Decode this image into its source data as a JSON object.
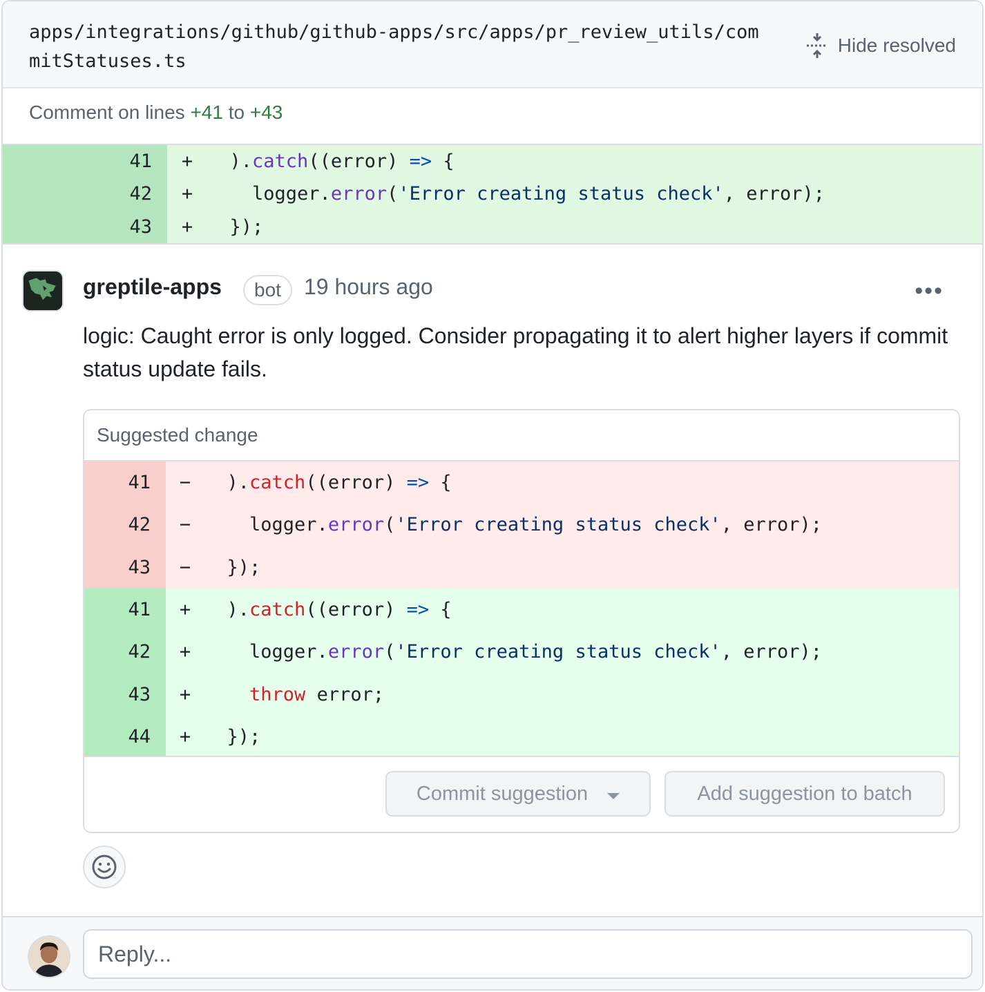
{
  "file": {
    "path": "apps/integrations/github/github-apps/src/apps/pr_review_utils/commitStatuses.ts",
    "hide_resolved_label": "Hide resolved"
  },
  "comment_range": {
    "prefix": "Comment on lines",
    "start": "+41",
    "joiner": "to",
    "end": "+43"
  },
  "top_diff": [
    {
      "line": "41",
      "sign": "+",
      "tokens": [
        [
          "pl",
          "  )."
        ],
        [
          "fn",
          "catch"
        ],
        [
          "pl",
          "((error) "
        ],
        [
          "op",
          "=>"
        ],
        [
          "pl",
          " {"
        ]
      ]
    },
    {
      "line": "42",
      "sign": "+",
      "tokens": [
        [
          "pl",
          "    logger."
        ],
        [
          "fn",
          "error"
        ],
        [
          "pl",
          "("
        ],
        [
          "str",
          "'Error creating status check'"
        ],
        [
          "pl",
          ", error);"
        ]
      ]
    },
    {
      "line": "43",
      "sign": "+",
      "tokens": [
        [
          "pl",
          "  });"
        ]
      ]
    }
  ],
  "comment": {
    "author": "greptile-apps",
    "badge": "bot",
    "time": "19 hours ago",
    "menu": "•••",
    "body": "logic: Caught error is only logged. Consider propagating it to alert higher layers if commit status update fails."
  },
  "suggestion": {
    "title": "Suggested change",
    "removed": [
      {
        "line": "41",
        "sign": "−",
        "tokens": [
          [
            "pl",
            "  )."
          ],
          [
            "fnr",
            "catch"
          ],
          [
            "pl",
            "((error) "
          ],
          [
            "op",
            "=>"
          ],
          [
            "pl",
            " {"
          ]
        ]
      },
      {
        "line": "42",
        "sign": "−",
        "tokens": [
          [
            "pl",
            "    logger."
          ],
          [
            "fn",
            "error"
          ],
          [
            "pl",
            "("
          ],
          [
            "str",
            "'Error creating status check'"
          ],
          [
            "pl",
            ", error);"
          ]
        ]
      },
      {
        "line": "43",
        "sign": "−",
        "tokens": [
          [
            "pl",
            "  });"
          ]
        ]
      }
    ],
    "added": [
      {
        "line": "41",
        "sign": "+",
        "tokens": [
          [
            "pl",
            "  )."
          ],
          [
            "fnr",
            "catch"
          ],
          [
            "pl",
            "((error) "
          ],
          [
            "op",
            "=>"
          ],
          [
            "pl",
            " {"
          ]
        ]
      },
      {
        "line": "42",
        "sign": "+",
        "tokens": [
          [
            "pl",
            "    logger."
          ],
          [
            "fn",
            "error"
          ],
          [
            "pl",
            "("
          ],
          [
            "str",
            "'Error creating status check'"
          ],
          [
            "pl",
            ", error);"
          ]
        ]
      },
      {
        "line": "43",
        "sign": "+",
        "tokens": [
          [
            "pl",
            "    "
          ],
          [
            "kw",
            "throw"
          ],
          [
            "pl",
            " error;"
          ]
        ]
      },
      {
        "line": "44",
        "sign": "+",
        "tokens": [
          [
            "pl",
            "  });"
          ]
        ]
      }
    ],
    "commit_label": "Commit suggestion",
    "batch_label": "Add suggestion to batch"
  },
  "reply": {
    "placeholder": "Reply..."
  },
  "icons": {
    "hide_resolved": "fold-icon",
    "emoji": "smiley-icon",
    "menu": "kebab-horizontal-icon",
    "commit_dropdown": "triangle-down-icon"
  }
}
